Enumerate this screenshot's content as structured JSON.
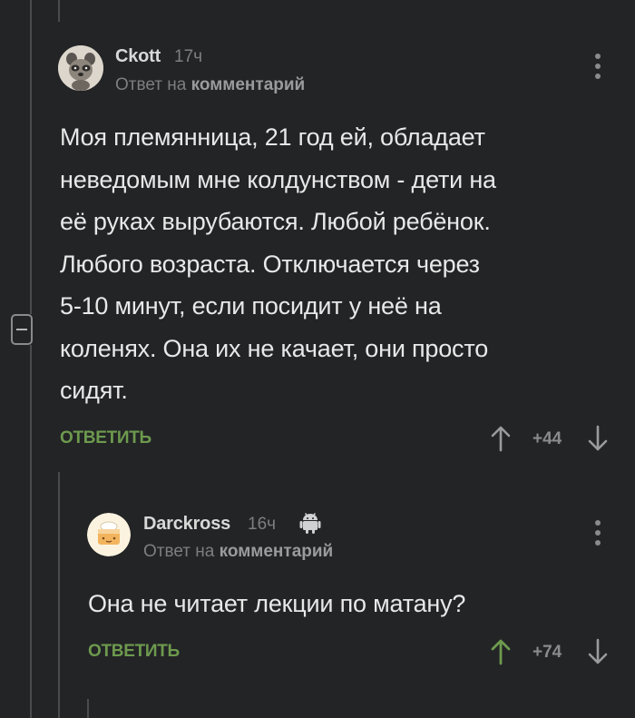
{
  "comments": [
    {
      "author": "Ckott",
      "time": "17ч",
      "reply_prefix": "Ответ на",
      "reply_target": "комментарий",
      "text": [
        "Моя племянница, 21 год ей, обладает",
        "неведомым мне колдунством - дети на",
        "её руках вырубаются. Любой ребёнок.",
        "Любого возраста. Отключается через",
        "5-10 минут, если посидит у неё на",
        "коленях. Она их не качает, они просто",
        "сидят."
      ],
      "reply_label": "ОТВЕТИТЬ",
      "rating": "+44",
      "avatar_icon": "raccoon-avatar-icon"
    },
    {
      "author": "Darckross",
      "time": "16ч",
      "platform_icon": "android-icon",
      "reply_prefix": "Ответ на",
      "reply_target": "комментарий",
      "text": [
        "Она не читает лекции по матану?"
      ],
      "reply_label": "ОТВЕТИТЬ",
      "rating": "+74",
      "upvoted": true,
      "avatar_icon": "cake-avatar-icon"
    }
  ],
  "colors": {
    "background": "#232426",
    "accent_green": "#6d9a4e",
    "muted": "#8a8b8d",
    "thread_line": "#4a4b4d"
  }
}
